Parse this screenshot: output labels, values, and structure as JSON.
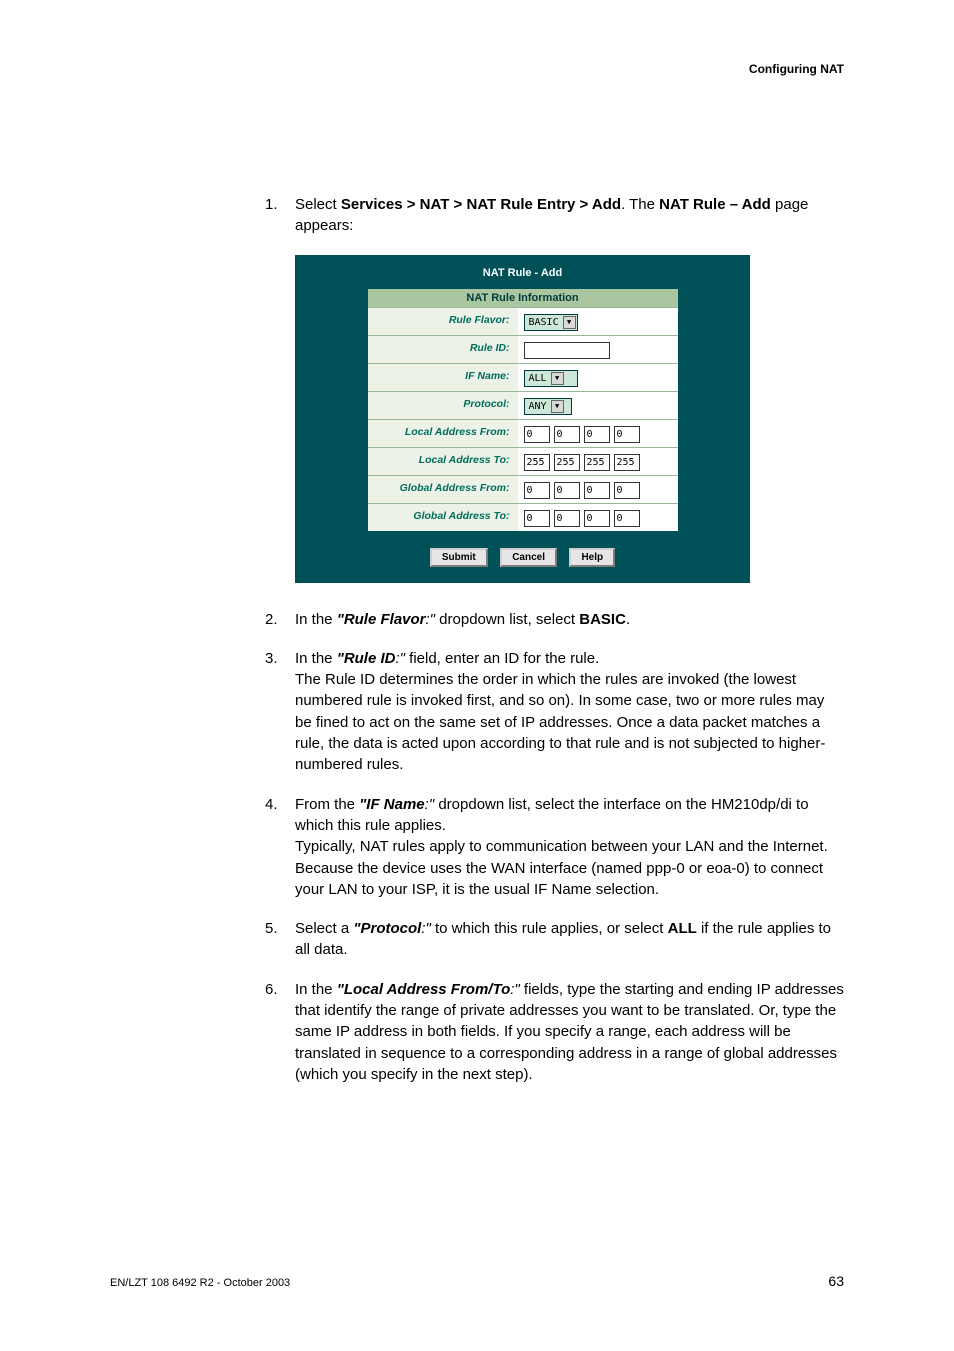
{
  "header": {
    "title": "Configuring NAT"
  },
  "footer": {
    "left": "EN/LZT 108 6492 R2 - October 2003",
    "right": "63"
  },
  "steps": {
    "s1": {
      "num": "1.",
      "pre": "Select ",
      "path": "Services > NAT > NAT Rule Entry > Add",
      "mid": ". The ",
      "bold2": "NAT Rule – Add",
      "tail": " page appears:"
    },
    "s2": {
      "num": "2.",
      "pre": "In the ",
      "bi": "\"Rule Flavor",
      "i": ":\"",
      "post": " dropdown list, select ",
      "bold": "BASIC",
      "tail": "."
    },
    "s3": {
      "num": "3.",
      "pre": "In the ",
      "bi": "\"Rule ID",
      "i": ":\"",
      "post": " field, enter an ID for the rule.",
      "body": "The Rule ID determines the order in which the rules are invoked (the lowest numbered rule is invoked first, and so on). In some case, two or more rules may be fined to act on the same set of IP addresses. Once a data packet matches a rule, the data is acted upon according to that rule and is not subjected to higher-numbered rules."
    },
    "s4": {
      "num": "4.",
      "pre": "From the ",
      "bi": "\"IF Name",
      "i": ":\"",
      "post": " dropdown list, select the interface on the HM210dp/di to which this rule applies.",
      "body": "Typically, NAT rules apply to communication between your LAN and the Internet. Because the device uses the WAN interface (named ppp-0 or eoa-0) to connect your LAN to your ISP, it is the usual IF Name selection."
    },
    "s5": {
      "num": "5.",
      "pre": "Select a ",
      "bi": "\"Protocol",
      "i": ":\"",
      "post": " to which this rule applies, or select ",
      "bold": "ALL",
      "tail": " if the rule applies to all data."
    },
    "s6": {
      "num": "6.",
      "pre": "In the ",
      "bi": "\"Local Address From/To",
      "i": ":\"",
      "post": " fields, type the starting and ending IP addresses that identify the range of private addresses you want to be translated. Or, type the same IP address in both fields. If you specify a range, each address will be translated in sequence to a corresponding address in a range of global addresses (which you specify in the next step)."
    }
  },
  "shot": {
    "title": "NAT Rule - Add",
    "section_header": "NAT Rule Information",
    "rows": {
      "flavor": {
        "label": "Rule Flavor:",
        "value": "BASIC"
      },
      "id": {
        "label": "Rule ID:",
        "value": ""
      },
      "ifname": {
        "label": "IF Name:",
        "value": "ALL"
      },
      "protocol": {
        "label": "Protocol:",
        "value": "ANY"
      },
      "laf": {
        "label": "Local Address From:",
        "o1": "0",
        "o2": "0",
        "o3": "0",
        "o4": "0"
      },
      "lat": {
        "label": "Local Address To:",
        "o1": "255",
        "o2": "255",
        "o3": "255",
        "o4": "255"
      },
      "gaf": {
        "label": "Global Address From:",
        "o1": "0",
        "o2": "0",
        "o3": "0",
        "o4": "0"
      },
      "gat": {
        "label": "Global Address To:",
        "o1": "0",
        "o2": "0",
        "o3": "0",
        "o4": "0"
      }
    },
    "buttons": {
      "submit": "Submit",
      "cancel": "Cancel",
      "help": "Help"
    }
  }
}
